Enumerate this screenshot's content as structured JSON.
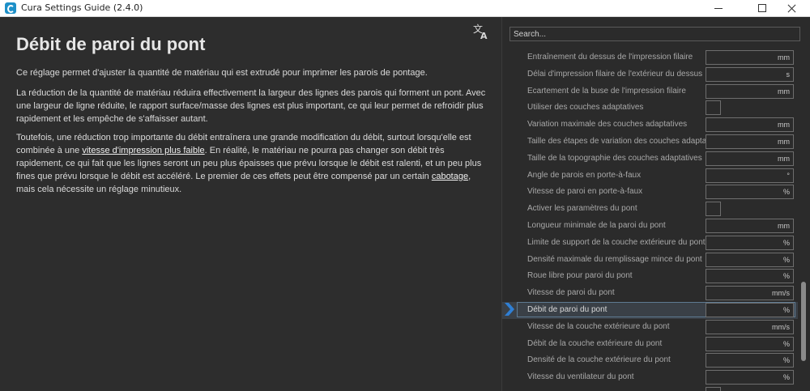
{
  "window": {
    "title": "Cura Settings Guide (2.4.0)"
  },
  "article": {
    "title": "Débit de paroi du pont",
    "p1": "Ce réglage permet d'ajuster la quantité de matériau qui est extrudé pour imprimer les parois de pontage.",
    "p2": "La réduction de la quantité de matériau réduira effectivement la largeur des lignes des parois qui forment un pont. Avec une largeur de ligne réduite, le rapport surface/masse des lignes est plus important, ce qui leur permet de refroidir plus rapidement et les empêche de s'affaisser autant.",
    "p3_a": "Toutefois, une réduction trop importante du débit entraînera une grande modification du débit, surtout lorsqu'elle est combinée à une ",
    "p3_link1": "vitesse d'impression plus faible",
    "p3_b": ". En réalité, le matériau ne pourra pas changer son débit très rapidement, ce qui fait que les lignes seront un peu plus épaisses que prévu lorsque le débit est ralenti, et un peu plus fines que prévu lorsque le débit est accéléré. Le premier de ces effets peut être compensé par un certain ",
    "p3_link2": "cabotage",
    "p3_c": ", mais cela nécessite un réglage minutieux."
  },
  "search": {
    "placeholder": "Search..."
  },
  "settings": [
    {
      "label": "Entraînement du dessus de l'impression filaire",
      "unit": "mm",
      "kind": "field"
    },
    {
      "label": "Délai d'impression filaire de l'extérieur du dessus",
      "unit": "s",
      "kind": "field"
    },
    {
      "label": "Ecartement de la buse de l'impression filaire",
      "unit": "mm",
      "kind": "field"
    },
    {
      "label": "Utiliser des couches adaptatives",
      "unit": "",
      "kind": "check"
    },
    {
      "label": "Variation maximale des couches adaptatives",
      "unit": "mm",
      "kind": "field"
    },
    {
      "label": "Taille des étapes de variation des couches adaptatives",
      "unit": "mm",
      "kind": "field"
    },
    {
      "label": "Taille de la topographie des couches adaptatives",
      "unit": "mm",
      "kind": "field"
    },
    {
      "label": "Angle de parois en porte-à-faux",
      "unit": "°",
      "kind": "field"
    },
    {
      "label": "Vitesse de paroi en porte-à-faux",
      "unit": "%",
      "kind": "field"
    },
    {
      "label": "Activer les paramètres du pont",
      "unit": "",
      "kind": "check"
    },
    {
      "label": "Longueur minimale de la paroi du pont",
      "unit": "mm",
      "kind": "field"
    },
    {
      "label": "Limite de support de la couche extérieure du pont",
      "unit": "%",
      "kind": "field"
    },
    {
      "label": "Densité maximale du remplissage mince du pont",
      "unit": "%",
      "kind": "field"
    },
    {
      "label": "Roue libre pour paroi du pont",
      "unit": "%",
      "kind": "field"
    },
    {
      "label": "Vitesse de paroi du pont",
      "unit": "mm/s",
      "kind": "field"
    },
    {
      "label": "Débit de paroi du pont",
      "unit": "%",
      "kind": "field",
      "selected": true
    },
    {
      "label": "Vitesse de la couche extérieure du pont",
      "unit": "mm/s",
      "kind": "field"
    },
    {
      "label": "Débit de la couche extérieure du pont",
      "unit": "%",
      "kind": "field"
    },
    {
      "label": "Densité de la couche extérieure du pont",
      "unit": "%",
      "kind": "field"
    },
    {
      "label": "Vitesse du ventilateur du pont",
      "unit": "%",
      "kind": "field"
    },
    {
      "label": "",
      "unit": "",
      "kind": "check"
    }
  ],
  "colors": {
    "background": "#2b2b2b",
    "selected_row": "#3a4047",
    "chevron": "#2f7fd4"
  }
}
